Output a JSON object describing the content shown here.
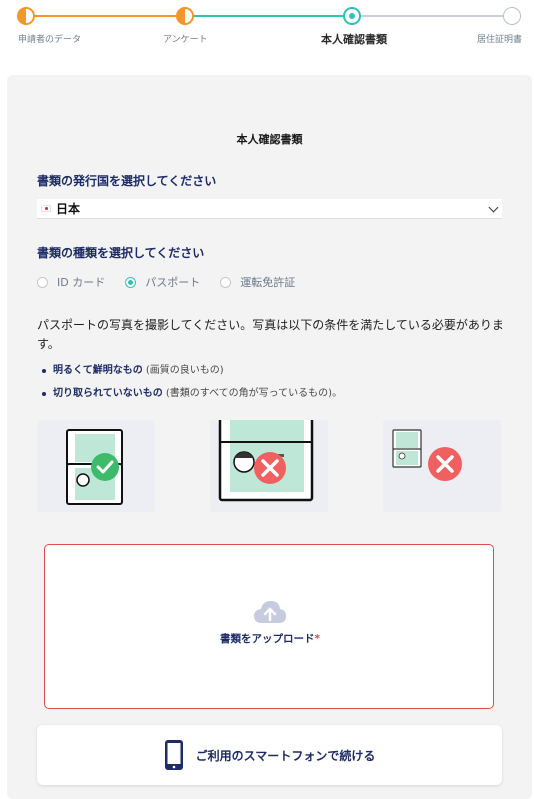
{
  "stepper": {
    "steps": [
      {
        "label": "申請者のデータ",
        "state": "done"
      },
      {
        "label": "アンケート",
        "state": "done"
      },
      {
        "label": "本人確認書類",
        "state": "current"
      },
      {
        "label": "居住証明書",
        "state": "todo"
      }
    ],
    "colors": {
      "done": "#f5962b",
      "current": "#2fc3b7",
      "todo": "#b8bec8"
    }
  },
  "card": {
    "title": "本人確認書類",
    "country_label": "書類の発行国を選択してください",
    "country_value": "日本",
    "country_flag_icon": "japan-flag-icon",
    "doc_type_label": "書類の種類を選択してください",
    "doc_types": [
      {
        "label": "ID カード",
        "selected": false
      },
      {
        "label": "パスポート",
        "selected": true
      },
      {
        "label": "運転免許証",
        "selected": false
      }
    ],
    "instructions": "パスポートの写真を撮影してください。写真は以下の条件を満たしている必要があります。",
    "conditions": [
      {
        "bold": "明るくて鮮明なもの",
        "note": " (画質の良いもの)"
      },
      {
        "bold": "切り取られていないもの",
        "note": " (書類のすべての角が写っているもの)。"
      }
    ],
    "examples": [
      {
        "icon": "passport-good-example-icon",
        "status": "check-icon"
      },
      {
        "icon": "passport-cropped-example-icon",
        "status": "cross-icon"
      },
      {
        "icon": "passport-small-example-icon",
        "status": "cross-icon"
      }
    ],
    "upload": {
      "label": "書類をアップロード",
      "required_mark": "*",
      "icon": "cloud-upload-icon",
      "border_color": "#e24b4b"
    },
    "phone_button": {
      "label": "ご利用のスマートフォンで続ける",
      "icon": "smartphone-icon"
    }
  },
  "colors": {
    "accent_orange": "#f5962b",
    "accent_teal": "#2fc3b7",
    "navy": "#1d2b66",
    "error_red": "#e24b4b"
  }
}
